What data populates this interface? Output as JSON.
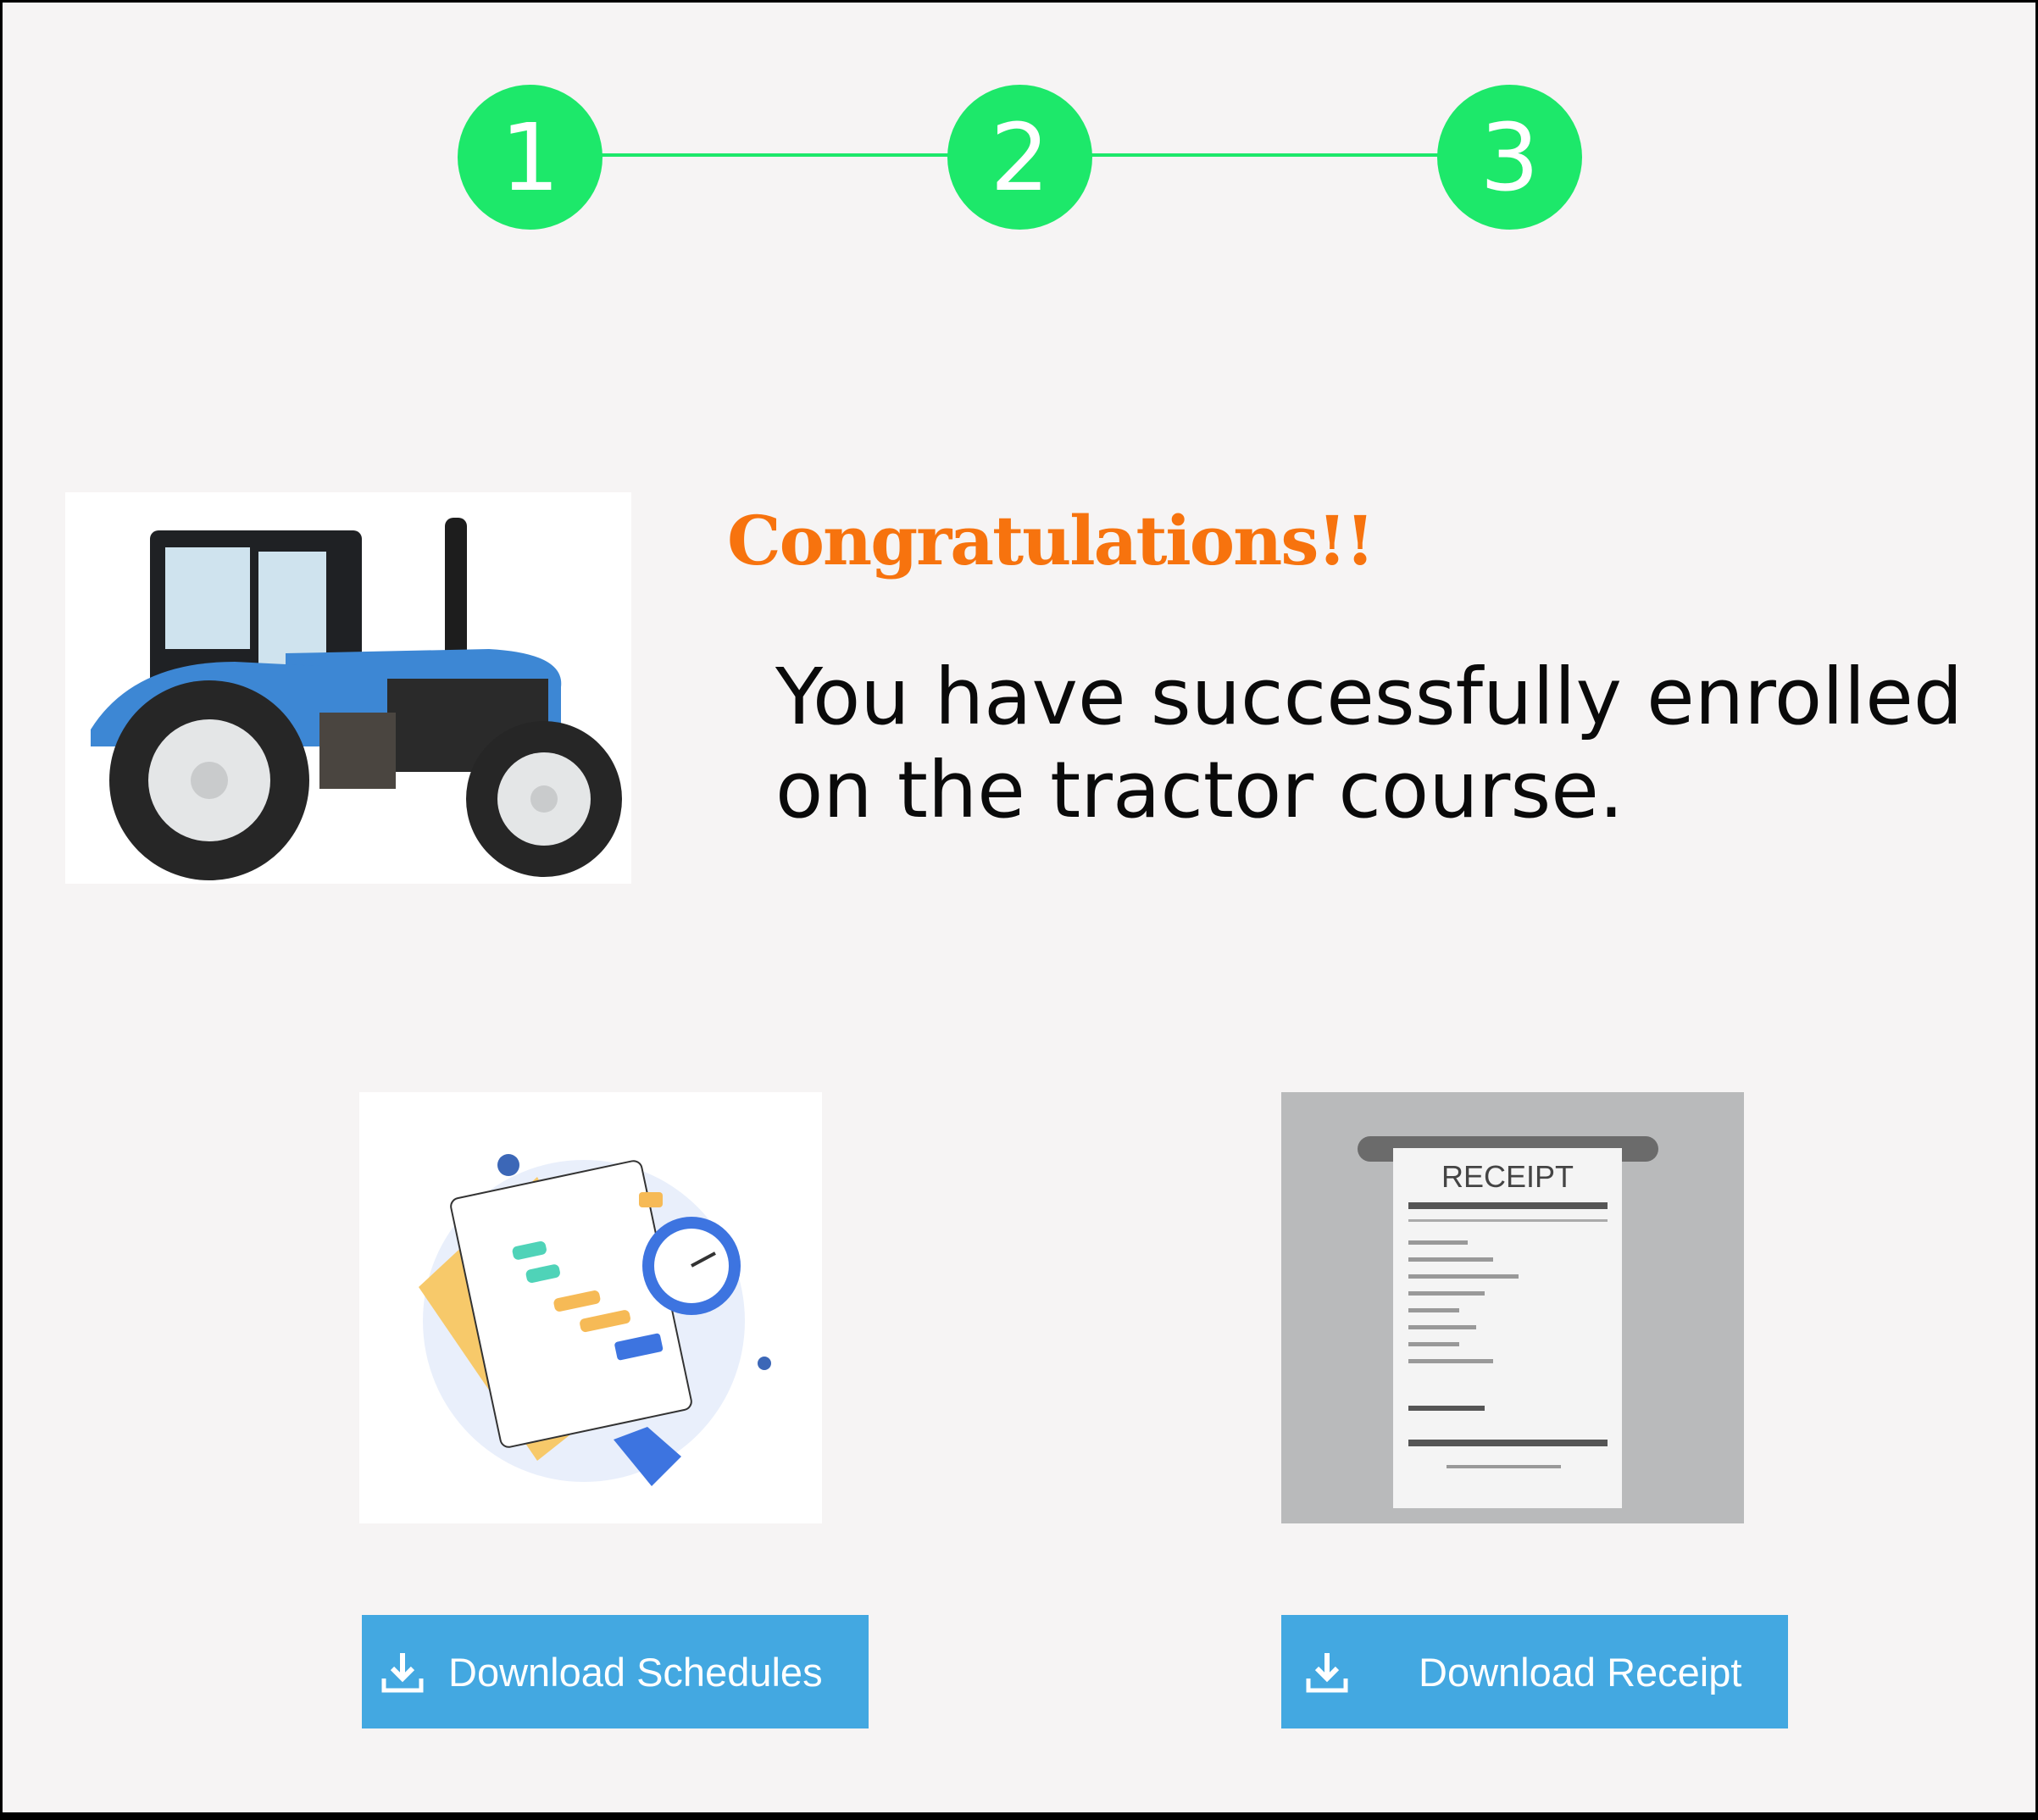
{
  "stepper": {
    "steps": [
      "1",
      "2",
      "3"
    ],
    "active_color": "#1de86a"
  },
  "hero": {
    "image_icon": "tractor-illustration",
    "title": "Congratulations!!",
    "message": "You have successfully enrolled on the tractor course."
  },
  "cards": {
    "schedule": {
      "image_icon": "schedule-documents-stopwatch-illustration",
      "button_label": "Download Schedules",
      "button_icon": "download-icon"
    },
    "receipt": {
      "image_icon": "receipt-illustration",
      "receipt_heading": "RECEIPT",
      "button_label": "Download Receipt",
      "button_icon": "download-icon"
    }
  },
  "colors": {
    "accent": "#1de86a",
    "title": "#f7730e",
    "button": "#43a8e1",
    "background": "#f6f4f4"
  }
}
